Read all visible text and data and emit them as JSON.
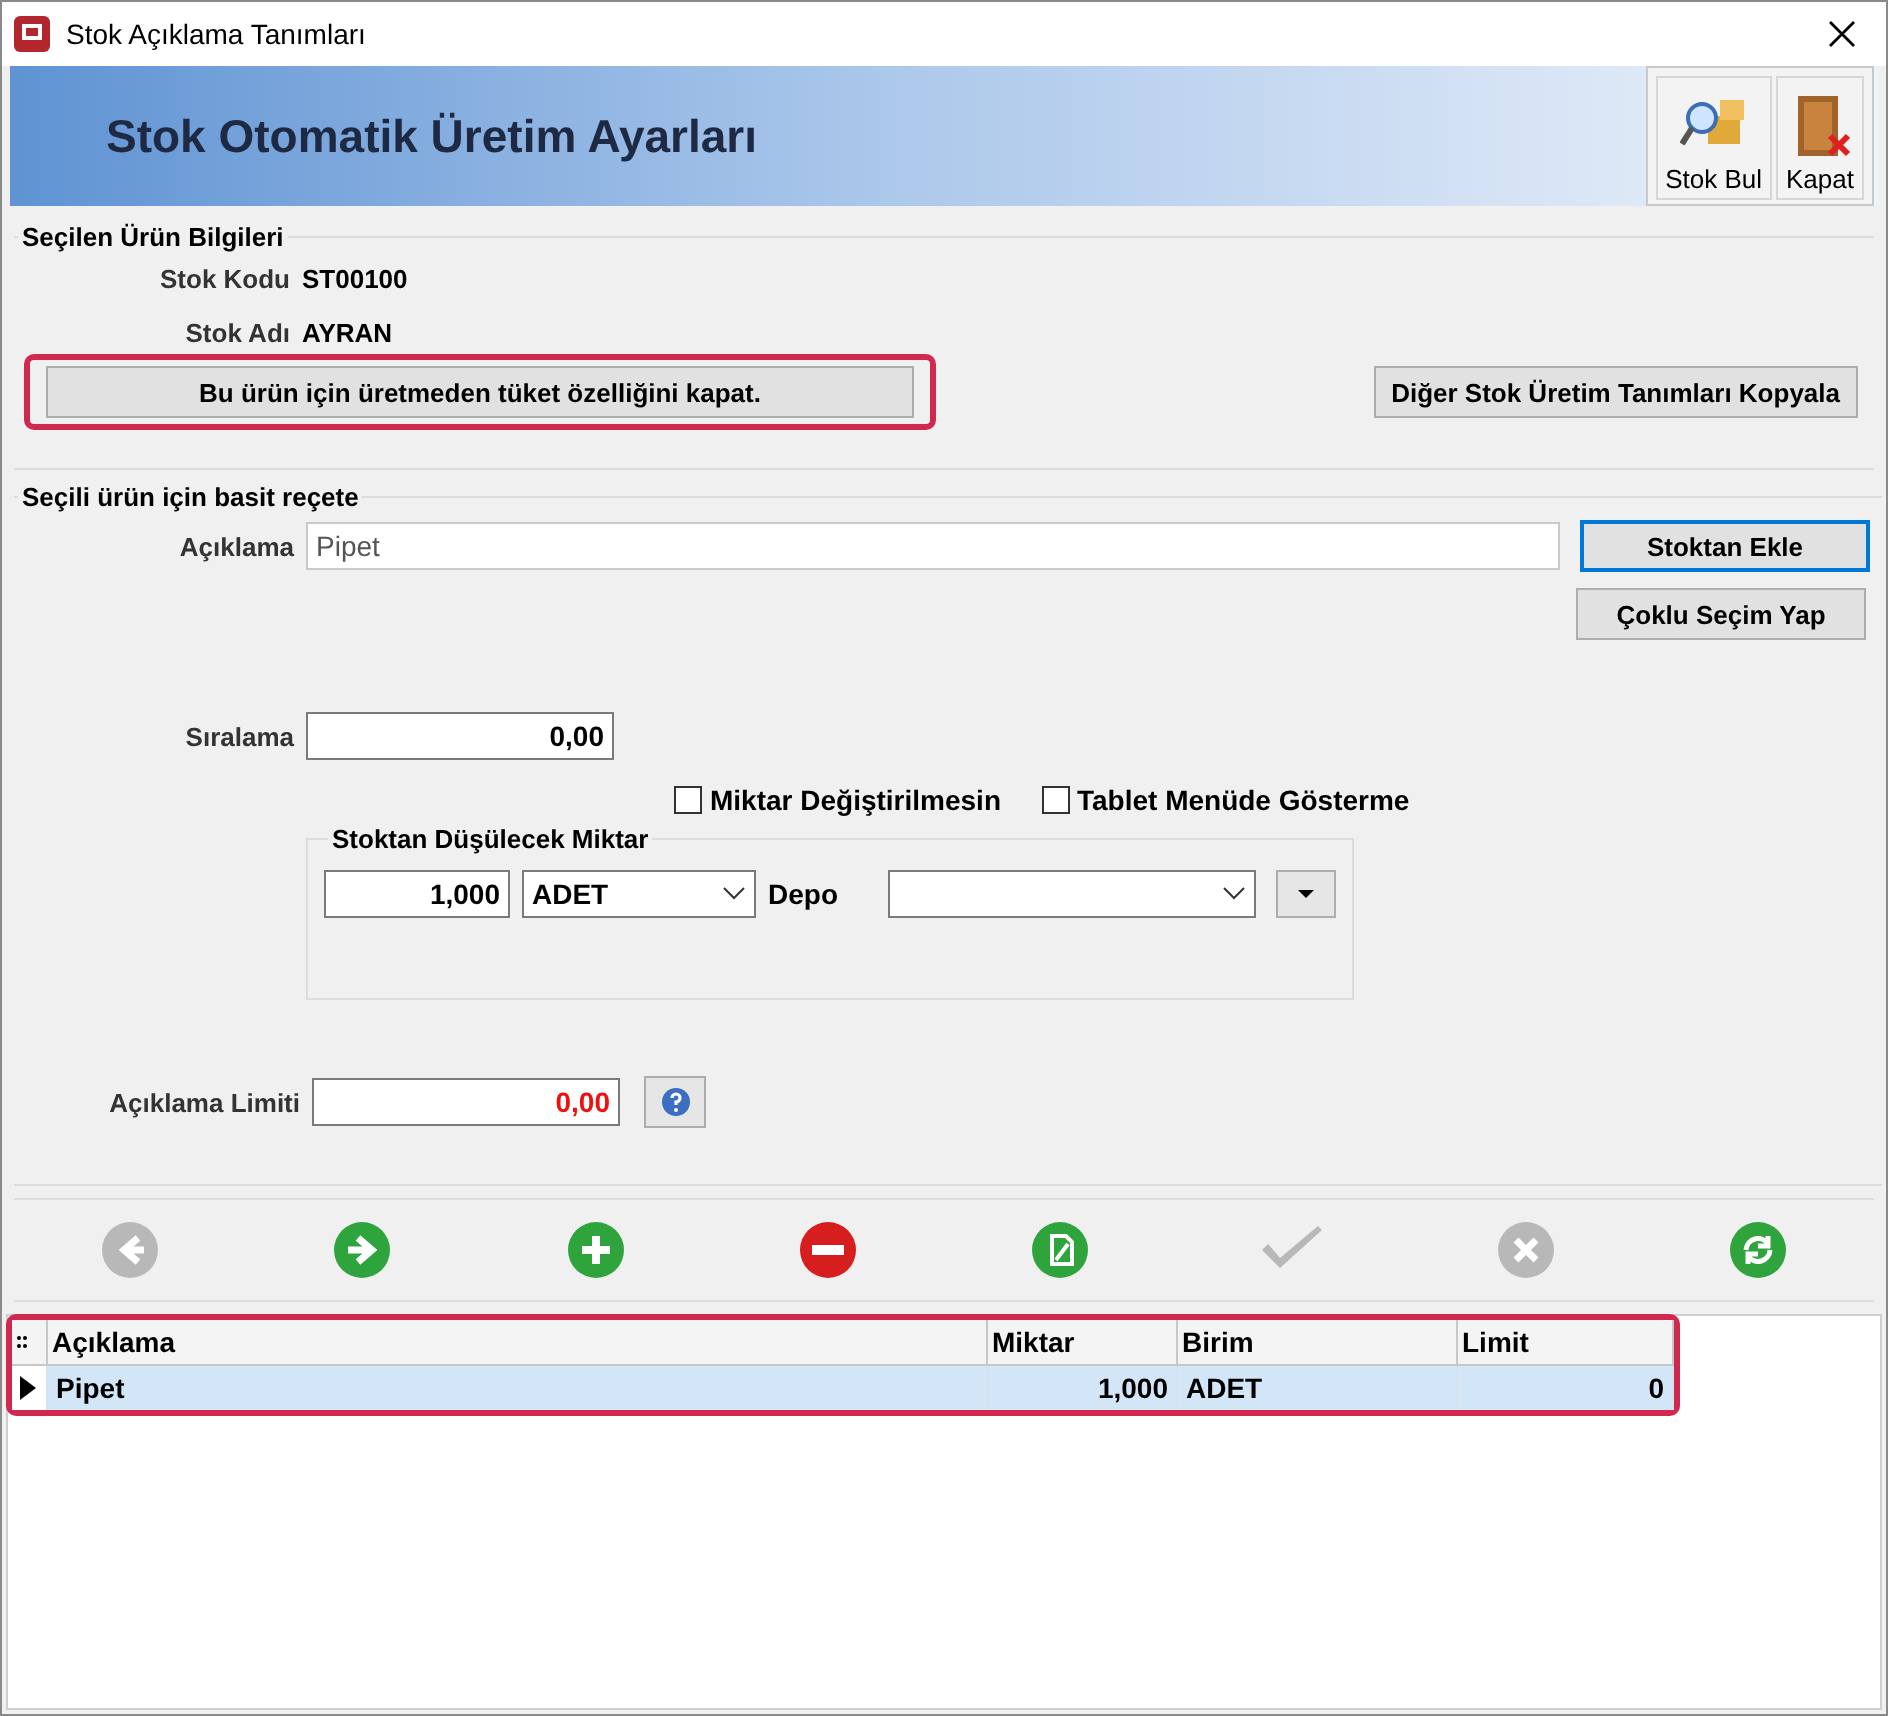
{
  "window": {
    "title": "Stok Açıklama Tanımları"
  },
  "header": {
    "title": "Stok Otomatik Üretim Ayarları",
    "tools": [
      {
        "label": "Stok Bul",
        "kind": "find"
      },
      {
        "label": "Kapat",
        "kind": "exit"
      }
    ]
  },
  "product_info": {
    "legend": "Seçilen Ürün Bilgileri",
    "fields": [
      {
        "label": "Stok Kodu",
        "value": "ST00100"
      },
      {
        "label": "Stok Adı",
        "value": "AYRAN"
      }
    ],
    "toggle_button": "Bu ürün için üretmeden tüket özelliğini kapat.",
    "highlighted": true,
    "copy_button": "Diğer Stok Üretim Tanımları Kopyala"
  },
  "recipe": {
    "legend": "Seçili ürün için basit reçete",
    "description": {
      "label": "Açıklama",
      "value": "Pipet"
    },
    "add_button": "Stoktan Ekle",
    "multi_button": "Çoklu Seçim Yap",
    "order": {
      "label": "Sıralama",
      "value": "0,00"
    },
    "checkboxes": [
      {
        "label": "Miktar Değiştirilmesin",
        "checked": false
      },
      {
        "label": "Tablet Menüde Gösterme",
        "checked": false
      }
    ],
    "deduct": {
      "legend": "Stoktan Düşülecek Miktar",
      "quantity": "1,000",
      "unit": "ADET",
      "warehouse_label": "Depo"
    },
    "limit": {
      "label": "Açıklama Limiti",
      "value": "0,00"
    }
  },
  "toolbar": [
    {
      "kind": "prev",
      "disabled": true
    },
    {
      "kind": "next",
      "disabled": false
    },
    {
      "kind": "add",
      "disabled": false
    },
    {
      "kind": "delete",
      "disabled": false
    },
    {
      "kind": "edit",
      "disabled": false
    },
    {
      "kind": "confirm",
      "disabled": true
    },
    {
      "kind": "cancel",
      "disabled": true
    },
    {
      "kind": "refresh",
      "disabled": false
    }
  ],
  "grid": {
    "highlighted": true,
    "columns": [
      "Açıklama",
      "Miktar",
      "Birim",
      "Limit"
    ],
    "rows": [
      {
        "cells": [
          "Pipet",
          "1,000",
          "ADET",
          "0"
        ],
        "selected": true
      }
    ]
  }
}
